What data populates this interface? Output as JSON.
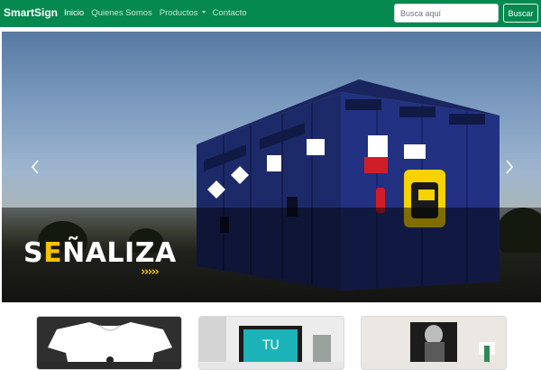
{
  "navbar": {
    "brand": "SmartSign",
    "links": [
      {
        "label": "Inicio",
        "active": true
      },
      {
        "label": "Quienes Somos",
        "active": false
      },
      {
        "label": "Productos",
        "active": false,
        "dropdown": true
      },
      {
        "label": "Contacto",
        "active": false
      }
    ],
    "search_placeholder": "Busca aquí",
    "search_button": "Buscar"
  },
  "carousel": {
    "slide_title_prefix": "S",
    "slide_title_rest": "ÑALIZA",
    "slide_title_accent": "E",
    "chevrons": "›››››",
    "prev_icon": "chevron-left-icon",
    "next_icon": "chevron-right-icon"
  },
  "cards": [
    {
      "name": "product-card-tshirt"
    },
    {
      "name": "product-card-frame",
      "image_text": "TU"
    },
    {
      "name": "product-card-poster"
    }
  ],
  "colors": {
    "brand_green": "#06894f",
    "accent_yellow": "#f5c400"
  }
}
